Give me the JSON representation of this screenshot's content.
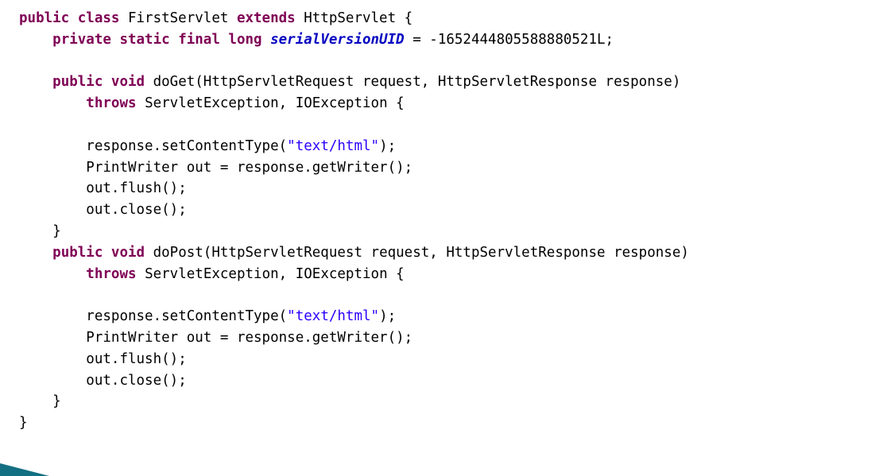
{
  "document": {
    "type": "java-source-code",
    "language": "Java",
    "class_name": "FirstServlet",
    "background_color": "#ffffff",
    "default_text_color": "#000000"
  },
  "syntax_colors": {
    "keyword": "#7F0055",
    "string": "#2A00FF",
    "field": "#0000C0",
    "plain": "#000000"
  },
  "decoration": {
    "corner_wedge_color": "#136f82",
    "corner_wedge_name": "bottom-left-teal-wedge"
  },
  "code": {
    "lines": [
      {
        "indent": 0,
        "tokens": [
          {
            "t": "kw",
            "s": "public class "
          },
          {
            "t": "plain",
            "s": "FirstServlet "
          },
          {
            "t": "kw",
            "s": "extends "
          },
          {
            "t": "plain",
            "s": "HttpServlet {"
          }
        ]
      },
      {
        "indent": 4,
        "tokens": [
          {
            "t": "kw",
            "s": "private static final long "
          },
          {
            "t": "field",
            "s": "serialVersionUID"
          },
          {
            "t": "plain",
            "s": " = -1652444805588880521L;"
          }
        ]
      },
      {
        "indent": 0,
        "tokens": []
      },
      {
        "indent": 4,
        "tokens": [
          {
            "t": "kw",
            "s": "public void "
          },
          {
            "t": "plain",
            "s": "doGet(HttpServletRequest request, HttpServletResponse response)"
          }
        ]
      },
      {
        "indent": 8,
        "tokens": [
          {
            "t": "kw",
            "s": "throws "
          },
          {
            "t": "plain",
            "s": "ServletException, IOException {"
          }
        ]
      },
      {
        "indent": 0,
        "tokens": []
      },
      {
        "indent": 8,
        "tokens": [
          {
            "t": "plain",
            "s": "response.setContentType("
          },
          {
            "t": "str",
            "s": "\"text/html\""
          },
          {
            "t": "plain",
            "s": ");"
          }
        ]
      },
      {
        "indent": 8,
        "tokens": [
          {
            "t": "plain",
            "s": "PrintWriter out = response.getWriter();"
          }
        ]
      },
      {
        "indent": 8,
        "tokens": [
          {
            "t": "plain",
            "s": "out.flush();"
          }
        ]
      },
      {
        "indent": 8,
        "tokens": [
          {
            "t": "plain",
            "s": "out.close();"
          }
        ]
      },
      {
        "indent": 4,
        "tokens": [
          {
            "t": "plain",
            "s": "}"
          }
        ]
      },
      {
        "indent": 4,
        "tokens": [
          {
            "t": "kw",
            "s": "public void "
          },
          {
            "t": "plain",
            "s": "doPost(HttpServletRequest request, HttpServletResponse response)"
          }
        ]
      },
      {
        "indent": 8,
        "tokens": [
          {
            "t": "kw",
            "s": "throws "
          },
          {
            "t": "plain",
            "s": "ServletException, IOException {"
          }
        ]
      },
      {
        "indent": 0,
        "tokens": []
      },
      {
        "indent": 8,
        "tokens": [
          {
            "t": "plain",
            "s": "response.setContentType("
          },
          {
            "t": "str",
            "s": "\"text/html\""
          },
          {
            "t": "plain",
            "s": ");"
          }
        ]
      },
      {
        "indent": 8,
        "tokens": [
          {
            "t": "plain",
            "s": "PrintWriter out = response.getWriter();"
          }
        ]
      },
      {
        "indent": 8,
        "tokens": [
          {
            "t": "plain",
            "s": "out.flush();"
          }
        ]
      },
      {
        "indent": 8,
        "tokens": [
          {
            "t": "plain",
            "s": "out.close();"
          }
        ]
      },
      {
        "indent": 4,
        "tokens": [
          {
            "t": "plain",
            "s": "}"
          }
        ]
      },
      {
        "indent": 0,
        "tokens": [
          {
            "t": "plain",
            "s": "}"
          }
        ]
      }
    ]
  }
}
